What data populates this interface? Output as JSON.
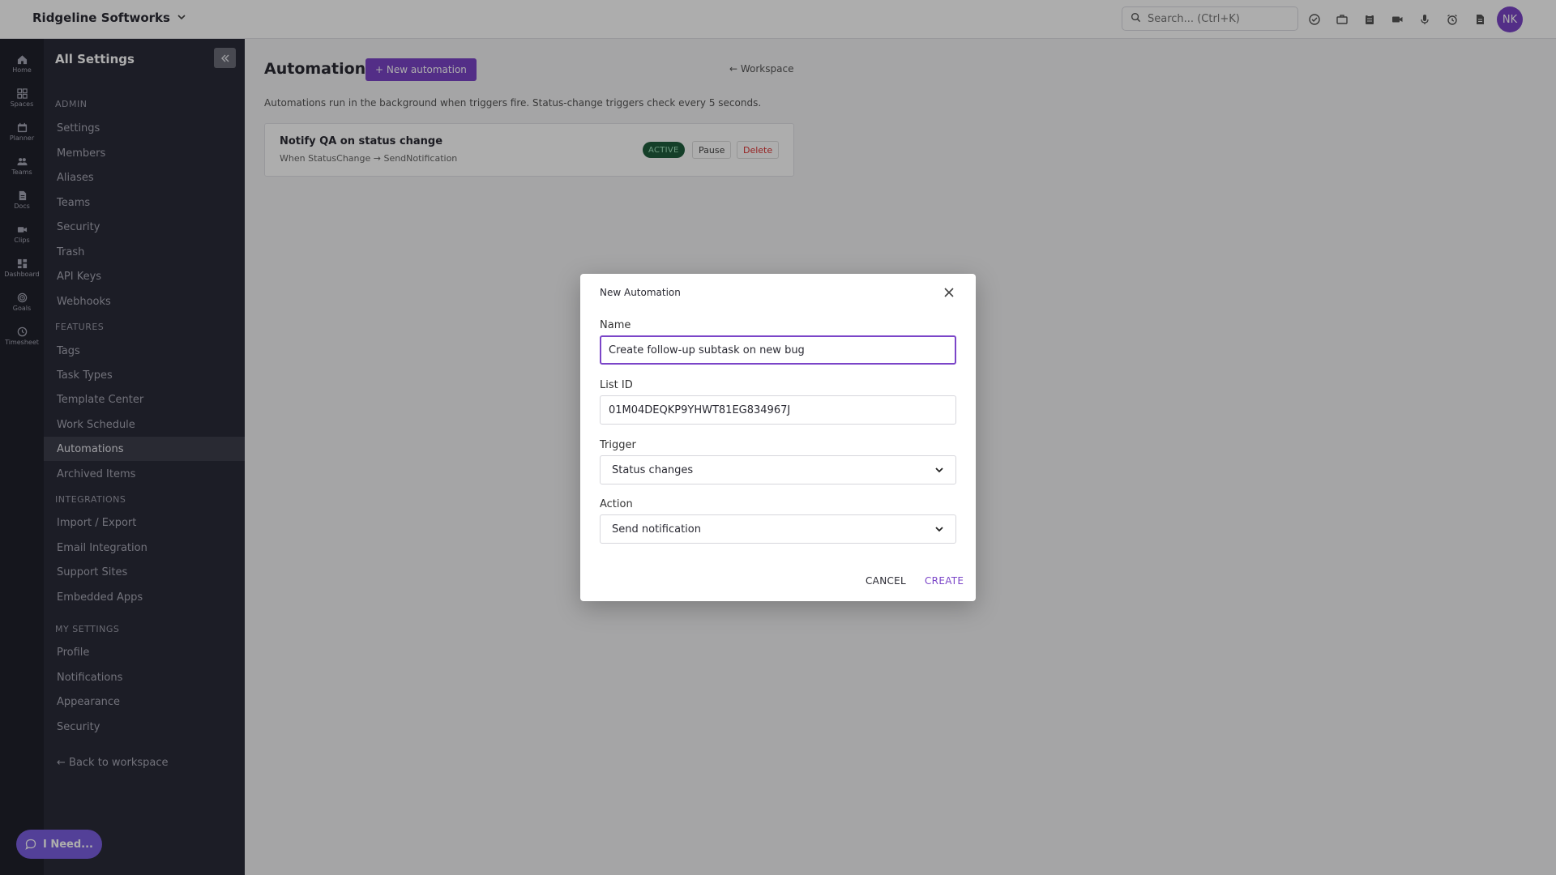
{
  "topbar": {
    "workspace_name": "Ridgeline Softworks",
    "search_placeholder": "Search... (Ctrl+K)",
    "avatar_initials": "NK",
    "icons": [
      "check-circle-icon",
      "briefcase-icon",
      "clipboard-icon",
      "video-icon",
      "microphone-icon",
      "alarm-icon",
      "document-icon"
    ]
  },
  "rail": {
    "items": [
      {
        "label": "Home",
        "icon": "home-icon"
      },
      {
        "label": "Spaces",
        "icon": "grid-icon"
      },
      {
        "label": "Planner",
        "icon": "calendar-icon"
      },
      {
        "label": "Teams",
        "icon": "people-icon"
      },
      {
        "label": "Docs",
        "icon": "doc-icon"
      },
      {
        "label": "Clips",
        "icon": "video-icon"
      },
      {
        "label": "Dashboard",
        "icon": "dashboard-icon"
      },
      {
        "label": "Goals",
        "icon": "target-icon"
      },
      {
        "label": "Timesheet",
        "icon": "clock-icon"
      }
    ]
  },
  "sidebar": {
    "title": "All Settings",
    "sections": {
      "admin": "ADMIN",
      "features": "FEATURES",
      "integrations": "INTEGRATIONS",
      "my_settings": "MY SETTINGS"
    },
    "admin_items": [
      "Settings",
      "Members",
      "Aliases",
      "Teams",
      "Security",
      "Trash",
      "API Keys",
      "Webhooks"
    ],
    "feature_items": [
      "Tags",
      "Task Types",
      "Template Center",
      "Work Schedule",
      "Automations",
      "Archived Items"
    ],
    "integration_items": [
      "Import / Export",
      "Email Integration",
      "Support Sites",
      "Embedded Apps"
    ],
    "my_items": [
      "Profile",
      "Notifications",
      "Appearance",
      "Security"
    ],
    "back_link": "← Back to workspace",
    "active_item": "Automations"
  },
  "help_button": {
    "label": "I Need..."
  },
  "main": {
    "title": "Automations",
    "new_button": "+ New automation",
    "workspace_link": "← Workspace",
    "description": "Automations run in the background when triggers fire. Status-change triggers check every 5 seconds.",
    "automations": [
      {
        "name": "Notify QA on status change",
        "summary": "When StatusChange → SendNotification",
        "status": "ACTIVE",
        "pause_label": "Pause",
        "delete_label": "Delete"
      }
    ]
  },
  "modal": {
    "title": "New Automation",
    "name_label": "Name",
    "name_value": "Create follow-up subtask on new bug",
    "list_id_label": "List ID",
    "list_id_value": "01M04DEQKP9YHWT81EG834967J",
    "trigger_label": "Trigger",
    "trigger_value": "Status changes",
    "action_label": "Action",
    "action_value": "Send notification",
    "cancel_label": "CANCEL",
    "create_label": "CREATE"
  },
  "colors": {
    "accent": "#7b45c8",
    "sidebar_bg": "#2a2b38",
    "rail_bg": "#20212b",
    "active_badge_bg": "#1f5d3d",
    "delete_text": "#dd3333"
  }
}
